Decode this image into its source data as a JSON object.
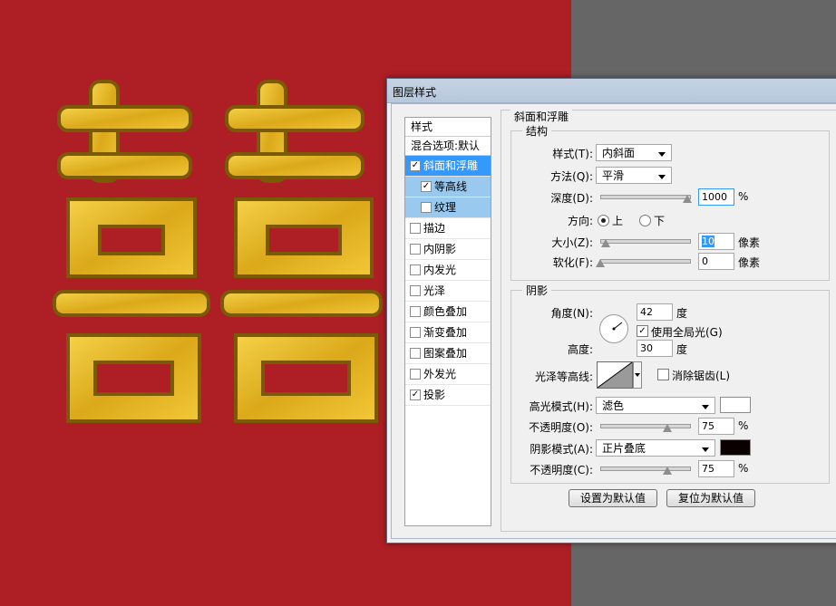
{
  "dialog": {
    "title": "图层样式"
  },
  "style_list": {
    "header": "样式",
    "blend_options": "混合选项:默认",
    "items": [
      {
        "label": "斜面和浮雕",
        "checked": true
      },
      {
        "label": "等高线",
        "checked": true
      },
      {
        "label": "纹理",
        "checked": false
      },
      {
        "label": "描边",
        "checked": false
      },
      {
        "label": "内阴影",
        "checked": false
      },
      {
        "label": "内发光",
        "checked": false
      },
      {
        "label": "光泽",
        "checked": false
      },
      {
        "label": "颜色叠加",
        "checked": false
      },
      {
        "label": "渐变叠加",
        "checked": false
      },
      {
        "label": "图案叠加",
        "checked": false
      },
      {
        "label": "外发光",
        "checked": false
      },
      {
        "label": "投影",
        "checked": true
      }
    ]
  },
  "bevel": {
    "title": "斜面和浮雕",
    "structure": {
      "title": "结构",
      "style_label": "样式(T):",
      "style_value": "内斜面",
      "technique_label": "方法(Q):",
      "technique_value": "平滑",
      "depth_label": "深度(D):",
      "depth_value": "1000",
      "depth_unit": "%",
      "depth_fraction": 0.98,
      "direction_label": "方向:",
      "direction_up": "上",
      "direction_down": "下",
      "size_label": "大小(Z):",
      "size_value": "10",
      "size_unit": "像素",
      "size_fraction": 0.06,
      "soften_label": "软化(F):",
      "soften_value": "0",
      "soften_unit": "像素",
      "soften_fraction": 0.0
    },
    "shading": {
      "title": "阴影",
      "angle_label": "角度(N):",
      "angle_value": "42",
      "angle_unit": "度",
      "global_light_label": "使用全局光(G)",
      "altitude_label": "高度:",
      "altitude_value": "30",
      "altitude_unit": "度",
      "gloss_contour_label": "光泽等高线:",
      "antialias_label": "消除锯齿(L)",
      "highlight_mode_label": "高光模式(H):",
      "highlight_mode_value": "滤色",
      "highlight_color": "#ffffff",
      "highlight_opacity_label": "不透明度(O):",
      "highlight_opacity_value": "75",
      "highlight_opacity_unit": "%",
      "highlight_opacity_fraction": 0.75,
      "shadow_mode_label": "阴影模式(A):",
      "shadow_mode_value": "正片叠底",
      "shadow_color": "#0a0000",
      "shadow_opacity_label": "不透明度(C):",
      "shadow_opacity_value": "75",
      "shadow_opacity_unit": "%",
      "shadow_opacity_fraction": 0.75
    },
    "make_default": "设置为默认值",
    "reset_default": "复位为默认值"
  },
  "colors": {
    "canvas_bg": "#ad1f24",
    "gold": "#e3b51e",
    "selection": "#3399ff"
  }
}
